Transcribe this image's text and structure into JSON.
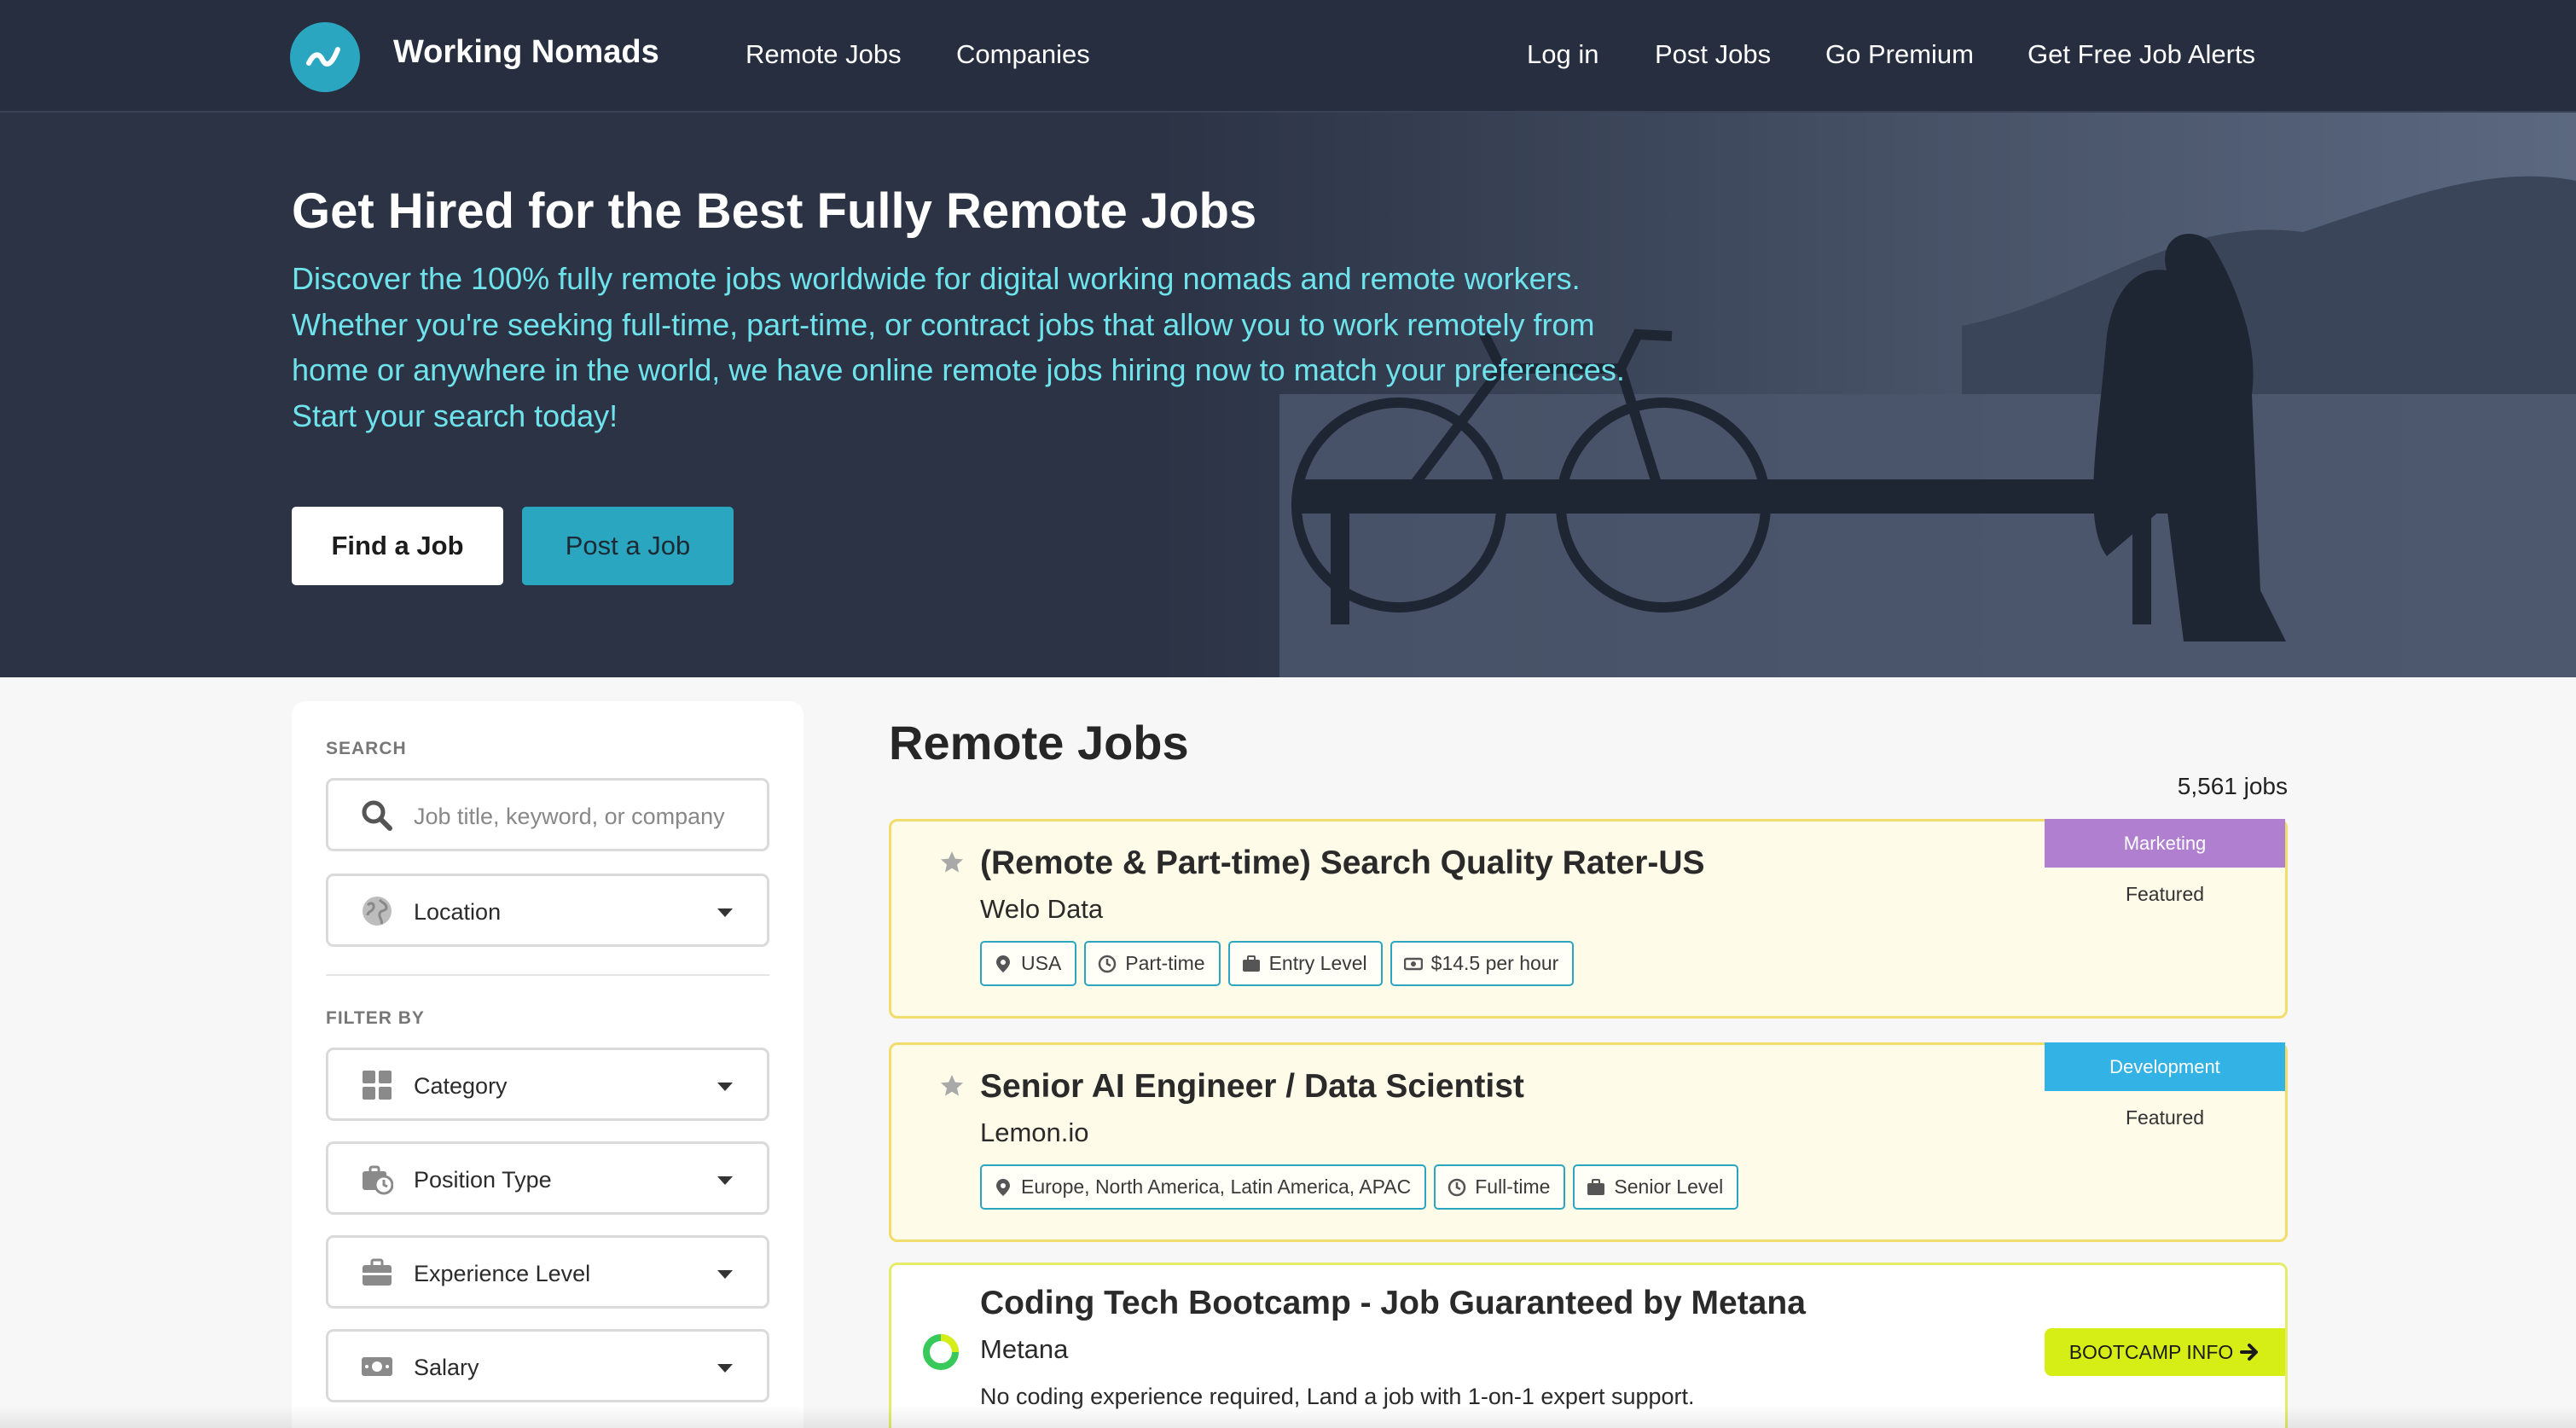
{
  "header": {
    "brand": "Working Nomads",
    "nav_left": [
      "Remote Jobs",
      "Companies"
    ],
    "nav_right": [
      "Log in",
      "Post Jobs",
      "Go Premium",
      "Get Free Job Alerts"
    ]
  },
  "hero": {
    "title": "Get Hired for the Best Fully Remote Jobs",
    "description": "Discover the 100% fully remote jobs worldwide for digital working nomads and remote workers. Whether you're seeking full-time, part-time, or contract jobs that allow you to work remotely from home or anywhere in the world, we have online remote jobs hiring now to match your preferences. Start your search today!",
    "find_button": "Find a Job",
    "post_button": "Post a Job"
  },
  "sidebar": {
    "search_label": "SEARCH",
    "search_placeholder": "Job title, keyword, or company",
    "location": "Location",
    "filter_label": "FILTER BY",
    "filters": [
      "Category",
      "Position Type",
      "Experience Level",
      "Salary"
    ]
  },
  "main": {
    "title": "Remote Jobs",
    "count": "5,561 jobs",
    "jobs": [
      {
        "title": "(Remote & Part-time) Search Quality Rater-US",
        "company": "Welo Data",
        "tags": [
          "USA",
          "Part-time",
          "Entry Level",
          "$14.5 per hour"
        ],
        "category": "Marketing",
        "featured": "Featured"
      },
      {
        "title": "Senior AI Engineer / Data Scientist",
        "company": "Lemon.io",
        "tags": [
          "Europe, North America, Latin America, APAC",
          "Full-time",
          "Senior Level"
        ],
        "category": "Development",
        "featured": "Featured"
      },
      {
        "title": "Coding Tech Bootcamp - Job Guaranteed by Metana",
        "company": "Metana",
        "description": "No coding experience required, Land a job with 1-on-1 expert support.",
        "cta": "BOOTCAMP INFO"
      }
    ]
  },
  "colors": {
    "header_bg": "#262e3f",
    "accent": "#2aa6c1",
    "hero_text": "#6fe3ec",
    "featured_bg": "#fffbe9",
    "featured_border": "#f2dc6b",
    "marketing": "#b07fd0",
    "development": "#33b2e6",
    "bootcamp": "#d6ee16"
  },
  "icons": [
    "logo-icon",
    "search-icon",
    "globe-icon",
    "grid-icon",
    "clock-briefcase-icon",
    "briefcase-icon",
    "money-icon",
    "star-icon",
    "map-pin-icon",
    "clock-icon",
    "arrow-right-icon",
    "metana-logo-icon"
  ]
}
